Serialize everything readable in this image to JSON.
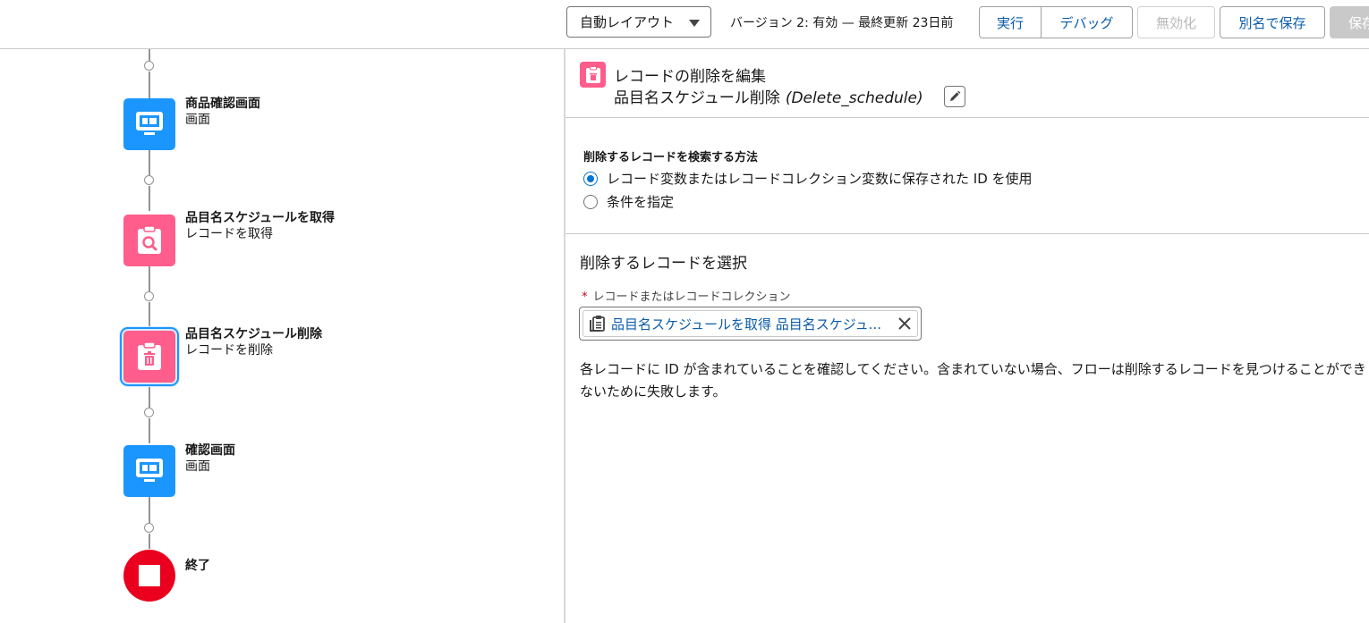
{
  "toolbar": {
    "layout_select": "自動レイアウト",
    "version_text": "バージョン 2: 有効 — 最終更新 23日前",
    "run": "実行",
    "debug": "デバッグ",
    "disable": "無効化",
    "save_as": "別名で保存",
    "save": "保存"
  },
  "flow": {
    "nodes": [
      {
        "title": "商品確認画面",
        "subtitle": "画面",
        "icon": "screen-icon",
        "color": "#1b96ff"
      },
      {
        "title": "品目名スケジュールを取得",
        "subtitle": "レコードを取得",
        "icon": "get-records-icon",
        "color": "#ff5d8b"
      },
      {
        "title": "品目名スケジュール削除",
        "subtitle": "レコードを削除",
        "icon": "delete-records-icon",
        "color": "#ff5d8b",
        "selected": true
      },
      {
        "title": "確認画面",
        "subtitle": "画面",
        "icon": "screen-icon",
        "color": "#1b96ff"
      }
    ],
    "end": {
      "title": "終了",
      "icon": "stop-icon",
      "color": "#ea001e"
    }
  },
  "panel": {
    "title": "レコードの削除を編集",
    "element_label": "品目名スケジュール削除",
    "element_api": "(Delete_schedule)",
    "find_method_label": "削除するレコードを検索する方法",
    "find_options": [
      {
        "label": "レコード変数またはレコードコレクション変数に保存された ID を使用",
        "selected": true
      },
      {
        "label": "条件を指定",
        "selected": false
      }
    ],
    "select_section_title": "削除するレコードを選択",
    "record_field_label": "レコードまたはレコードコレクション",
    "record_field_required": "*",
    "record_pill": "品目名スケジュールを取得 品目名スケジュ...",
    "help_text": "各レコードに ID が含まれていることを確認してください。含まれていない場合、フローは削除するレコードを見つけることができないために失敗します。"
  },
  "colors": {
    "brand_blue": "#0b5cab",
    "screen_blue": "#1b96ff",
    "record_pink": "#ff5d8b",
    "end_red": "#ea001e"
  }
}
